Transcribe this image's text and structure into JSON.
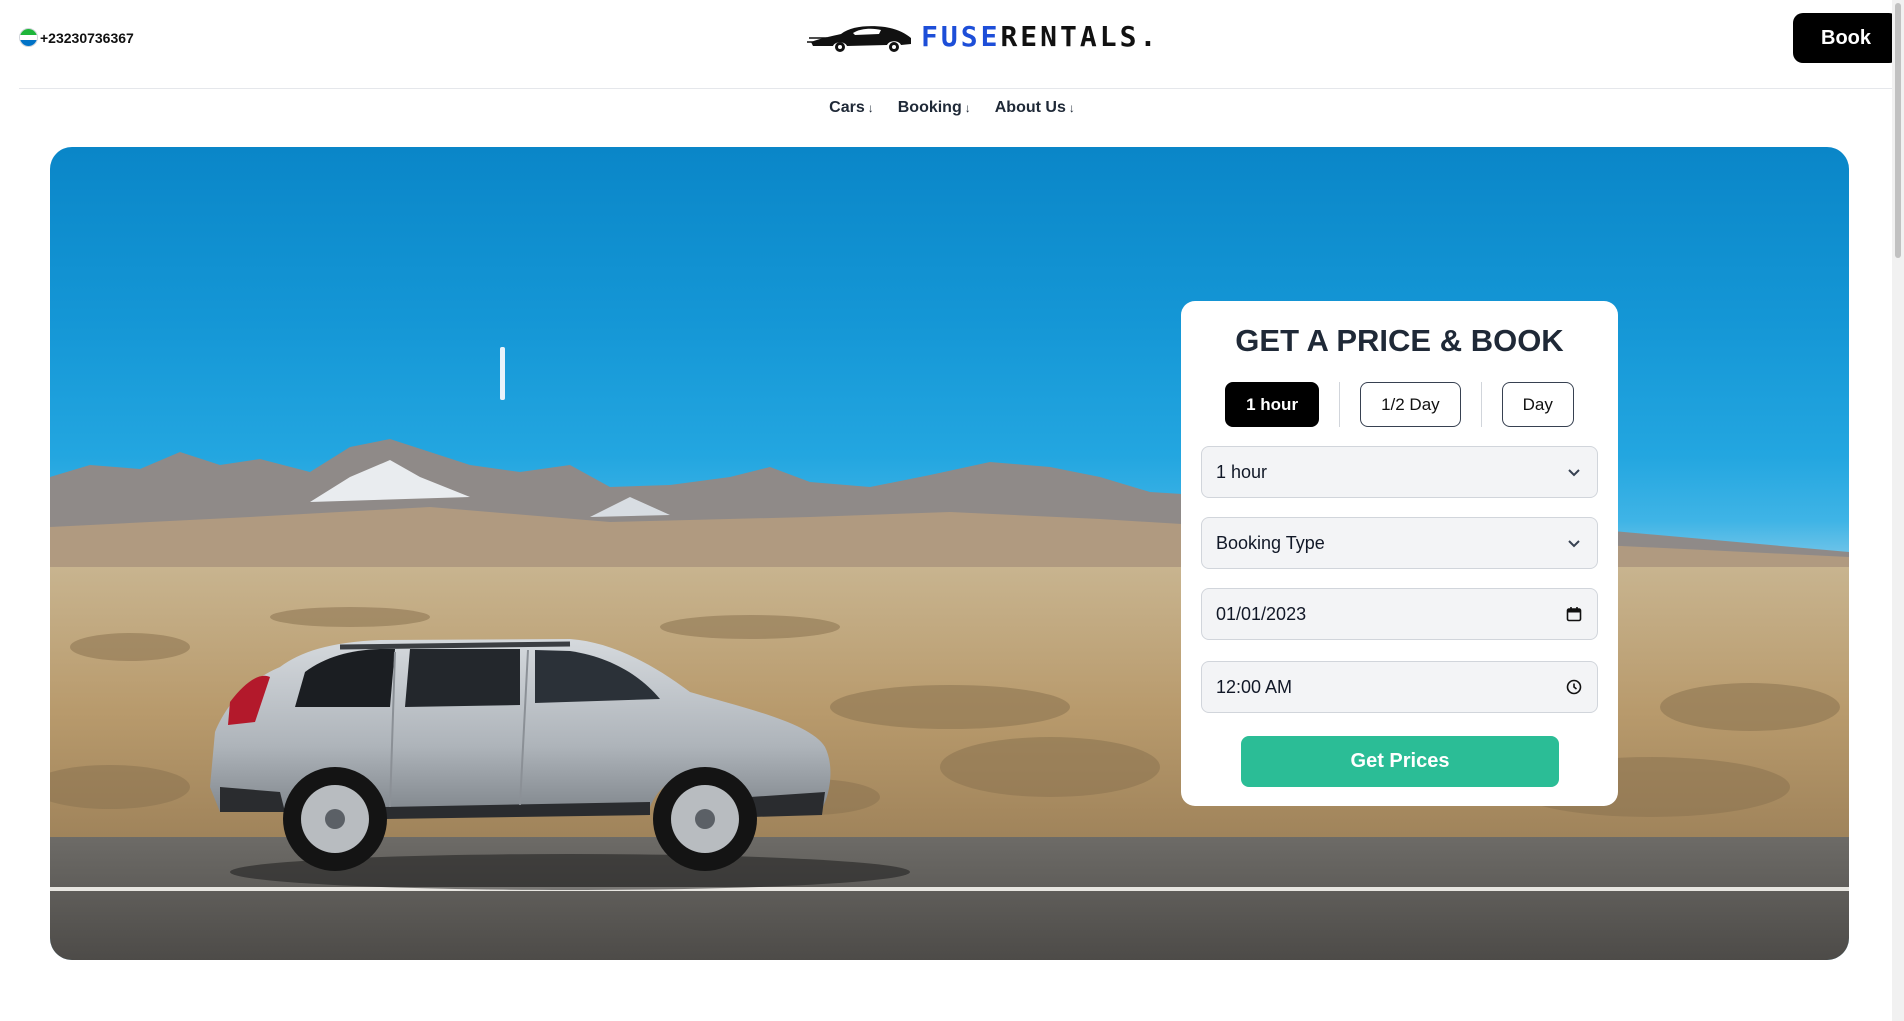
{
  "header": {
    "phone": "+23230736367",
    "logo": {
      "part1": "FUSE",
      "part2": "RENTALS."
    },
    "book_label": "Book"
  },
  "nav": {
    "items": [
      {
        "label": "Cars",
        "arrow": "↓"
      },
      {
        "label": "Booking",
        "arrow": "↓"
      },
      {
        "label": "About Us",
        "arrow": "↓"
      }
    ]
  },
  "booking": {
    "title": "GET A PRICE & BOOK",
    "durations": [
      "1 hour",
      "1/2 Day",
      "Day"
    ],
    "active_duration": "1 hour",
    "duration_select": "1 hour",
    "booking_type_select": "Booking Type",
    "date": "01/01/2023",
    "time": "12:00 AM",
    "submit_label": "Get Prices"
  },
  "colors": {
    "accent": "#2bbd96",
    "logo_blue": "#1d4ed8",
    "primary_button": "#000000"
  },
  "icons": {
    "select": "chevron-down-icon",
    "date": "calendar-icon",
    "time": "clock-icon"
  }
}
